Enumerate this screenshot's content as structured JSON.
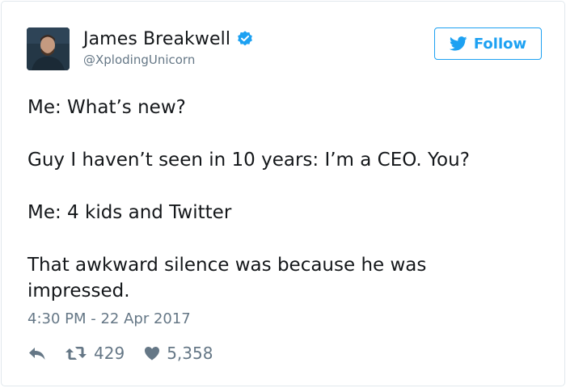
{
  "tweet": {
    "author": {
      "name": "James Breakwell",
      "handle": "@XplodingUnicorn",
      "verified": true,
      "avatar_icon": "profile-photo"
    },
    "follow_label": "Follow",
    "paragraphs": [
      "Me: What’s new?",
      "Guy I haven’t seen in 10 years: I’m a CEO. You?",
      "Me: 4 kids and Twitter",
      "That awkward silence was because he was impressed."
    ],
    "timestamp": "4:30 PM - 22 Apr 2017",
    "stats": {
      "retweets": "429",
      "likes": "5,358"
    }
  },
  "colors": {
    "accent": "#1da1f2",
    "text": "#14171a",
    "muted": "#657786",
    "border": "#e1e8ed"
  },
  "icons": {
    "verified": "verified-badge-icon",
    "follow": "twitter-bird-icon",
    "reply": "reply-icon",
    "retweet": "retweet-icon",
    "like": "heart-icon"
  }
}
